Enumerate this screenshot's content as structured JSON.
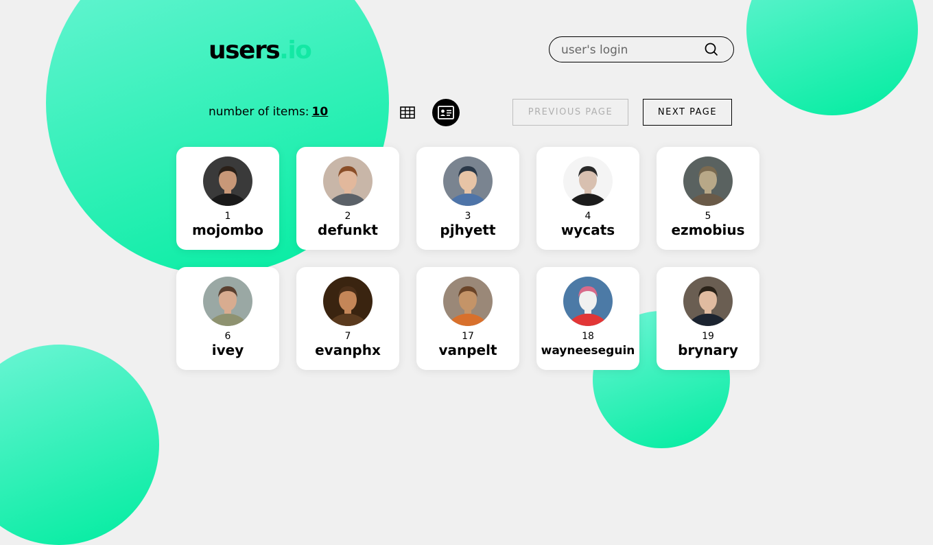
{
  "brand": {
    "name": "users",
    "accent": ".io",
    "accent_color": "#13e8a4"
  },
  "search": {
    "placeholder": "user's login",
    "value": "",
    "icon": "search-icon"
  },
  "toolbar": {
    "count_label": "number of items:",
    "count_value": "10",
    "views": [
      {
        "name": "grid-view",
        "icon": "table-grid-icon",
        "active": false
      },
      {
        "name": "card-view",
        "icon": "id-card-icon",
        "active": true
      }
    ],
    "prev_label": "PREVIOUS PAGE",
    "prev_disabled": true,
    "next_label": "NEXT PAGE"
  },
  "users": [
    {
      "id": "1",
      "login": "mojombo",
      "avatar_bg": "#3a3a3a",
      "skin": "#c89878",
      "hair": "#2a2018",
      "shirt": "#1a1a1a"
    },
    {
      "id": "2",
      "login": "defunkt",
      "avatar_bg": "#c8b6a8",
      "skin": "#e2b89c",
      "hair": "#8a4e28",
      "shirt": "#5b6168"
    },
    {
      "id": "3",
      "login": "pjhyett",
      "avatar_bg": "#7a8490",
      "skin": "#e7c4a6",
      "hair": "#2a3848",
      "shirt": "#4e74a8"
    },
    {
      "id": "4",
      "login": "wycats",
      "avatar_bg": "#f4f4f4",
      "skin": "#d8c0b0",
      "hair": "#2a2a2a",
      "shirt": "#1c1c1c"
    },
    {
      "id": "5",
      "login": "ezmobius",
      "avatar_bg": "#5a6260",
      "skin": "#b8a888",
      "hair": "#7a6a50",
      "shirt": "#6a5a48"
    },
    {
      "id": "6",
      "login": "ivey",
      "avatar_bg": "#9aa8a4",
      "skin": "#d8ac90",
      "hair": "#5a4030",
      "shirt": "#8e9270"
    },
    {
      "id": "7",
      "login": "evanphx",
      "avatar_bg": "#3a2410",
      "skin": "#c48658",
      "hair": "#4a2e18",
      "shirt": "#5a3a1e"
    },
    {
      "id": "17",
      "login": "vanpelt",
      "avatar_bg": "#9a8878",
      "skin": "#c49468",
      "hair": "#6a4428",
      "shirt": "#d8702c"
    },
    {
      "id": "18",
      "login": "wayneeseguin",
      "avatar_bg": "#4c7aa6",
      "skin": "#f0f0f0",
      "hair": "#d86a8a",
      "shirt": "#e23636"
    },
    {
      "id": "19",
      "login": "brynary",
      "avatar_bg": "#6a5e52",
      "skin": "#e0bba0",
      "hair": "#2a2218",
      "shirt": "#1c2430"
    }
  ]
}
